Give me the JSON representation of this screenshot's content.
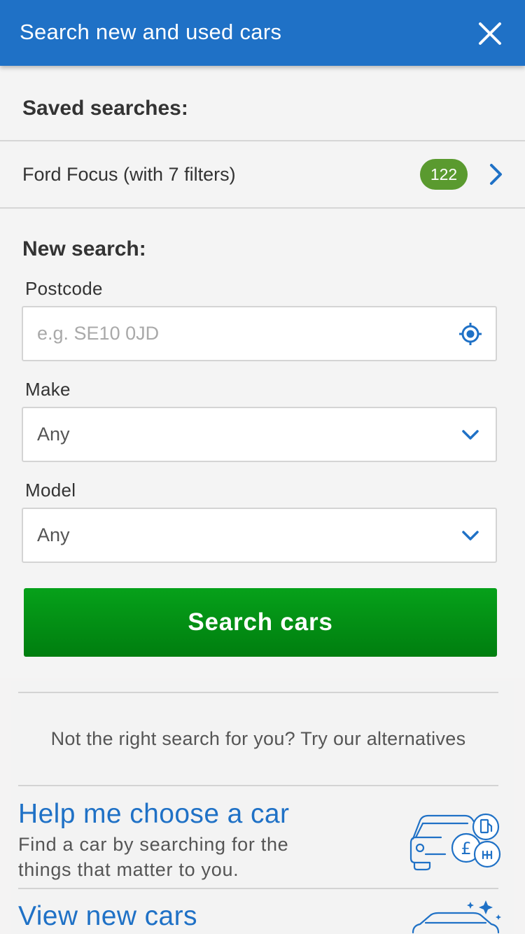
{
  "header": {
    "title": "Search new and used cars",
    "close_icon": "close-icon"
  },
  "saved": {
    "title": "Saved searches:",
    "items": [
      {
        "label": "Ford Focus (with 7 filters)",
        "count": "122",
        "icon": "chevron-right-icon"
      }
    ]
  },
  "new_search": {
    "title": "New search:",
    "postcode": {
      "label": "Postcode",
      "placeholder": "e.g. SE10 0JD",
      "value": "",
      "icon": "location-target-icon"
    },
    "make": {
      "label": "Make",
      "value": "Any",
      "icon": "chevron-down-icon"
    },
    "model": {
      "label": "Model",
      "value": "Any",
      "icon": "chevron-down-icon"
    },
    "submit_label": "Search cars"
  },
  "alternatives": {
    "intro": "Not the right search for you? Try our alternatives",
    "items": [
      {
        "title": "Help me choose a car",
        "description": "Find a car by searching for the things that matter to you.",
        "icon": "car-features-icon"
      },
      {
        "title": "View new cars",
        "description": "",
        "icon": "new-car-icon"
      }
    ]
  },
  "colors": {
    "header_bg": "#1f71c6",
    "link_blue": "#1f71c6",
    "badge_green": "#5a9a2f",
    "button_green": "#06a11a"
  }
}
